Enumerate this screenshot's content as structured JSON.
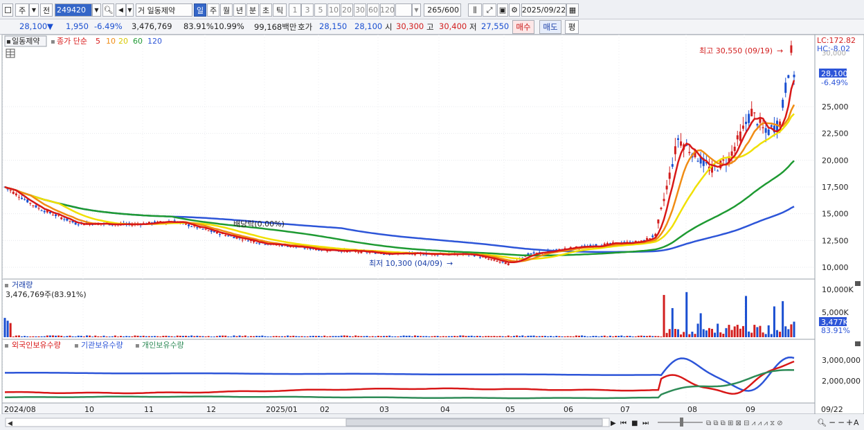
{
  "toolbar": {
    "market_label": "주",
    "prev_label": "전",
    "code": "249420",
    "stock_name": "거 일동제약",
    "periods": [
      "일",
      "주",
      "월",
      "년",
      "분",
      "초",
      "틱"
    ],
    "active_period": "일",
    "intervals": [
      "1",
      "3",
      "5",
      "10",
      "20",
      "30",
      "60",
      "120"
    ],
    "count": "265",
    "count_max": "/600",
    "date": "2025/09/22"
  },
  "quote": {
    "price": "28,100",
    "change": "1,950",
    "change_pct": "-6.49%",
    "volume": "3,476,769",
    "vol_ratio": "83.91%",
    "turnover": "10.99%",
    "amount": "99,168백만",
    "ask_label": "호가",
    "ask": "28,150",
    "bid": "28,100",
    "open_label": "시",
    "open": "30,300",
    "high_label": "고",
    "high": "30,400",
    "low_label": "저",
    "low": "27,550",
    "buy_label": "매수",
    "sell_label": "매도",
    "eval_label": "평"
  },
  "price_panel": {
    "stock_label": "일동제약",
    "ma_title": "종가 단순",
    "ma_periods": [
      "5",
      "10",
      "20",
      "60",
      "120"
    ],
    "lc_label": "LC:172.82",
    "hc_label": "HC:-8.02",
    "y_ticks": [
      "25,000",
      "22,500",
      "20,000",
      "17,500",
      "15,000",
      "12,500",
      "10,000"
    ],
    "top_tick": "30,000",
    "current_price": "28,100",
    "current_pct": "-6.49%",
    "high_annot": "최고 30,550 (09/19)",
    "low_annot": "최저 10,300 (04/09)",
    "dividend_annot": "배당락(0.00%)"
  },
  "volume_panel": {
    "title": "거래량",
    "value_label": "3,476,769주(83.91%)",
    "y_ticks": [
      "10,000K",
      "5,000K"
    ],
    "current": "3,477K",
    "current_pct": "83.91%"
  },
  "holdings_panel": {
    "series_labels": [
      "외국인보유수량",
      "기관보유수량",
      "개인보유수량"
    ],
    "y_ticks": [
      "3,000,000",
      "2,000,000"
    ]
  },
  "x_axis": {
    "labels": [
      "2024/08",
      "10",
      "11",
      "12",
      "2025/01",
      "02",
      "03",
      "04",
      "05",
      "06",
      "07",
      "08",
      "09"
    ],
    "end_label": "09/22"
  },
  "colors": {
    "up": "#d21e1e",
    "down": "#1a4fd1",
    "ma5": "#d81818",
    "ma10": "#f08c14",
    "ma20": "#f0e000",
    "ma60": "#1e9a32",
    "ma120": "#2d55d8",
    "foreign": "#d81818",
    "institution": "#2d55d8",
    "individual": "#2e8b57"
  },
  "chart_data": {
    "type": "candlestick",
    "price_ylim": [
      9500,
      31500
    ],
    "keypoints": {
      "dates": [
        "2024/08",
        "10",
        "11",
        "12",
        "2025/01",
        "02",
        "03",
        "04",
        "05",
        "06",
        "07",
        "08",
        "09",
        "09/22"
      ],
      "close_path": [
        17500,
        14200,
        13800,
        13500,
        12200,
        11600,
        11400,
        11000,
        10300,
        12000,
        12300,
        12500,
        22000,
        19000,
        24000,
        22500,
        28100
      ]
    },
    "ma120_path": [
      14600,
      14600,
      14500,
      13600,
      13000,
      12600,
      12000,
      11500,
      11600,
      11800,
      13500,
      15000,
      16500
    ],
    "ma60_path": [
      13900,
      14300,
      14500,
      13800,
      12800,
      12100,
      11800,
      11500,
      11400,
      11700,
      13000,
      17000,
      19500,
      21200
    ],
    "volume_ylim_k": [
      0,
      11000
    ],
    "holdings_ylim": [
      1500000,
      3700000
    ]
  }
}
